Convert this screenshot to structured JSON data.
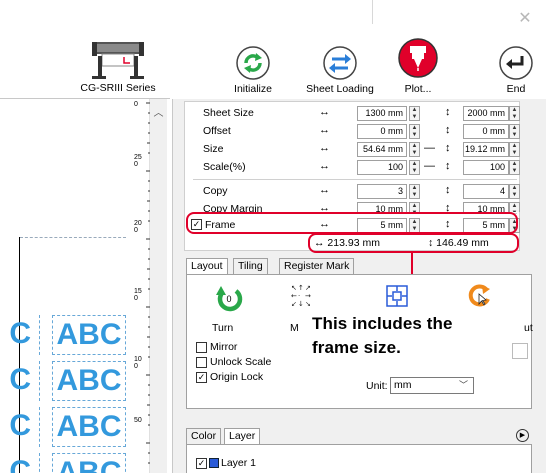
{
  "window": {
    "close_icon": "close-icon"
  },
  "toolbar": {
    "printer_label": "CG-SRIII Series",
    "buttons": [
      {
        "label": "Initialize",
        "icon": "initialize-icon",
        "color": "#2aa84a"
      },
      {
        "label": "Sheet Loading",
        "icon": "sheet-loading-icon",
        "color": "#2a7ed8"
      },
      {
        "label": "Plot...",
        "icon": "plot-icon",
        "color": "#e0002a"
      },
      {
        "label": "End",
        "icon": "end-icon",
        "color": "#222222"
      }
    ]
  },
  "properties": {
    "rows": [
      {
        "name": "Sheet Size",
        "h": "1300 mm",
        "v": "2000 mm"
      },
      {
        "name": "Offset",
        "h": "0 mm",
        "v": "0 mm"
      },
      {
        "name": "Size",
        "h": "54.64 mm",
        "v": "19.12 mm"
      },
      {
        "name": "Scale(%)",
        "h": "100",
        "v": "100"
      },
      {
        "name": "Copy",
        "h": "3",
        "v": "4"
      },
      {
        "name": "Copy Margin",
        "h": "10 mm",
        "v": "10 mm"
      },
      {
        "name": "Frame",
        "h": "5 mm",
        "v": "5 mm",
        "checked": true
      }
    ],
    "total_h": "↔ 213.93 mm",
    "total_v": "↕ 146.49 mm"
  },
  "tabs": [
    "Layout",
    "Tiling",
    "Register Mark"
  ],
  "layout": {
    "turn_label": "Turn",
    "m_label": "M",
    "ut_label": "ut",
    "options": [
      {
        "label": "Mirror",
        "checked": false
      },
      {
        "label": "Unlock Scale",
        "checked": false
      },
      {
        "label": "Origin Lock",
        "checked": true
      }
    ],
    "unit_label": "Unit:",
    "unit_value": "mm"
  },
  "callout": {
    "line1": "This includes the",
    "line2": "frame size."
  },
  "bottom_tabs": [
    "Color",
    "Layer"
  ],
  "layer": {
    "name": "Layer 1",
    "checked": true
  },
  "preview": {
    "text": "ABC",
    "partial_text": "C",
    "ruler_labels": [
      "0",
      "250",
      "200",
      "150",
      "100",
      "50"
    ]
  },
  "colors": {
    "highlight": "#e0002a",
    "accent_text": "#3399dd"
  }
}
